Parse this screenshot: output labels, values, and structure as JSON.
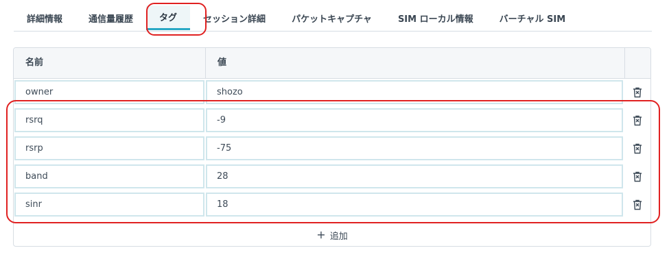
{
  "tabs": [
    {
      "label": "詳細情報"
    },
    {
      "label": "通信量履歴"
    },
    {
      "label": "タグ"
    },
    {
      "label": "セッション詳細"
    },
    {
      "label": "パケットキャプチャ"
    },
    {
      "label": "SIM ローカル情報"
    },
    {
      "label": "バーチャル SIM"
    }
  ],
  "active_tab": "タグ",
  "table": {
    "headers": {
      "name": "名前",
      "value": "値"
    },
    "rows": [
      {
        "name": "owner",
        "value": "shozo"
      },
      {
        "name": "rsrq",
        "value": "-9"
      },
      {
        "name": "rsrp",
        "value": "-75"
      },
      {
        "name": "band",
        "value": "28"
      },
      {
        "name": "sinr",
        "value": "18"
      }
    ],
    "add_label": "追加"
  },
  "colors": {
    "accent": "#29a8c4",
    "annotation": "#e02020"
  }
}
